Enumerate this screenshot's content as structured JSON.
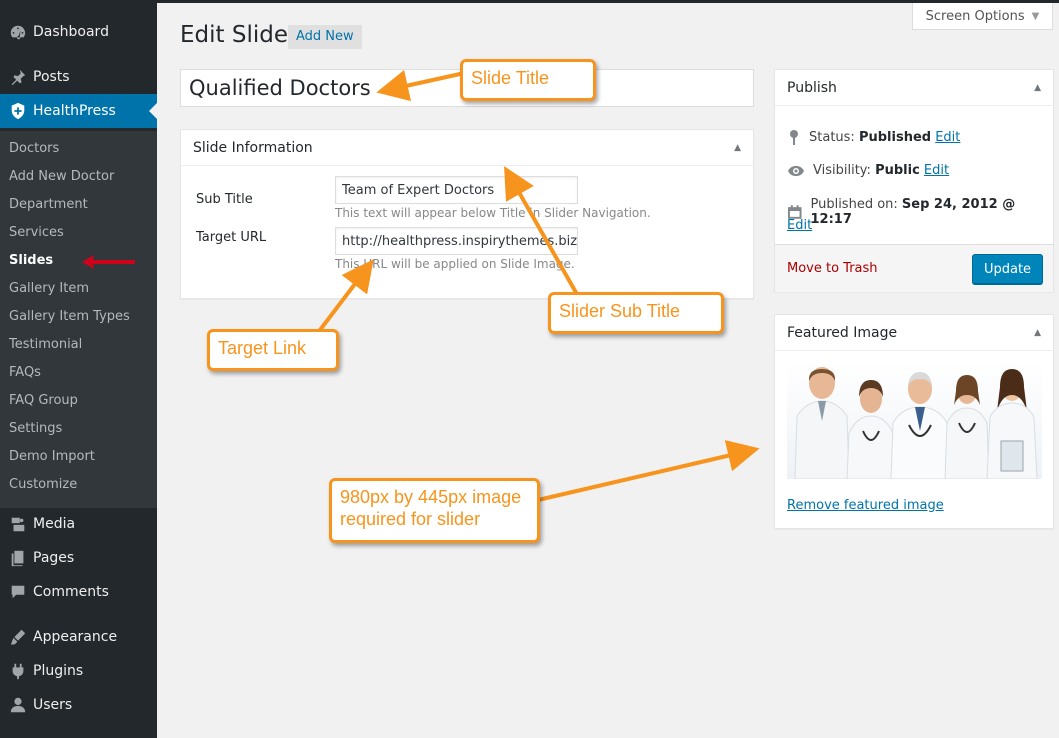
{
  "sidebar": {
    "top_items": [
      {
        "label": "Dashboard",
        "icon": "dashboard-icon"
      },
      {
        "label": "Posts",
        "icon": "pushpin-icon"
      },
      {
        "label": "HealthPress",
        "icon": "shield-icon"
      }
    ],
    "submenu": [
      "Doctors",
      "Add New Doctor",
      "Department",
      "Services",
      "Slides",
      "Gallery Item",
      "Gallery Item Types",
      "Testimonial",
      "FAQs",
      "FAQ Group",
      "Settings",
      "Demo Import",
      "Customize"
    ],
    "bottom_items": [
      {
        "label": "Media",
        "icon": "media-icon"
      },
      {
        "label": "Pages",
        "icon": "pages-icon"
      },
      {
        "label": "Comments",
        "icon": "comment-icon"
      },
      {
        "label": "Appearance",
        "icon": "paintbrush-icon"
      },
      {
        "label": "Plugins",
        "icon": "plugin-icon"
      },
      {
        "label": "Users",
        "icon": "user-icon"
      }
    ],
    "active_color": "#0073aa"
  },
  "header": {
    "title": "Edit Slide",
    "add_new": "Add New",
    "screen_options": "Screen Options"
  },
  "title_value": "Qualified Doctors",
  "slide_info": {
    "heading": "Slide Information",
    "sub_title_label": "Sub Title",
    "sub_title_value": "Team of Expert Doctors",
    "sub_title_desc": "This text will appear below Title in Slider Navigation.",
    "target_url_label": "Target URL",
    "target_url_value": "http://healthpress.inspirythemes.biz",
    "target_url_desc": "This URL will be applied on Slide Image."
  },
  "publish": {
    "heading": "Publish",
    "status_label": "Status:",
    "status_value": "Published",
    "visibility_label": "Visibility:",
    "visibility_value": "Public",
    "published_label": "Published on:",
    "published_value": "Sep 24, 2012 @ 12:17",
    "edit": "Edit",
    "trash": "Move to Trash",
    "update": "Update"
  },
  "featured": {
    "heading": "Featured Image",
    "remove": "Remove featured image"
  },
  "callouts": {
    "slide_title": "Slide Title",
    "slider_sub_title": "Slider Sub Title",
    "target_link": "Target Link",
    "image_size_line1": "980px by 445px image",
    "image_size_line2": "required for slider"
  },
  "accent_color": "#f7941d"
}
